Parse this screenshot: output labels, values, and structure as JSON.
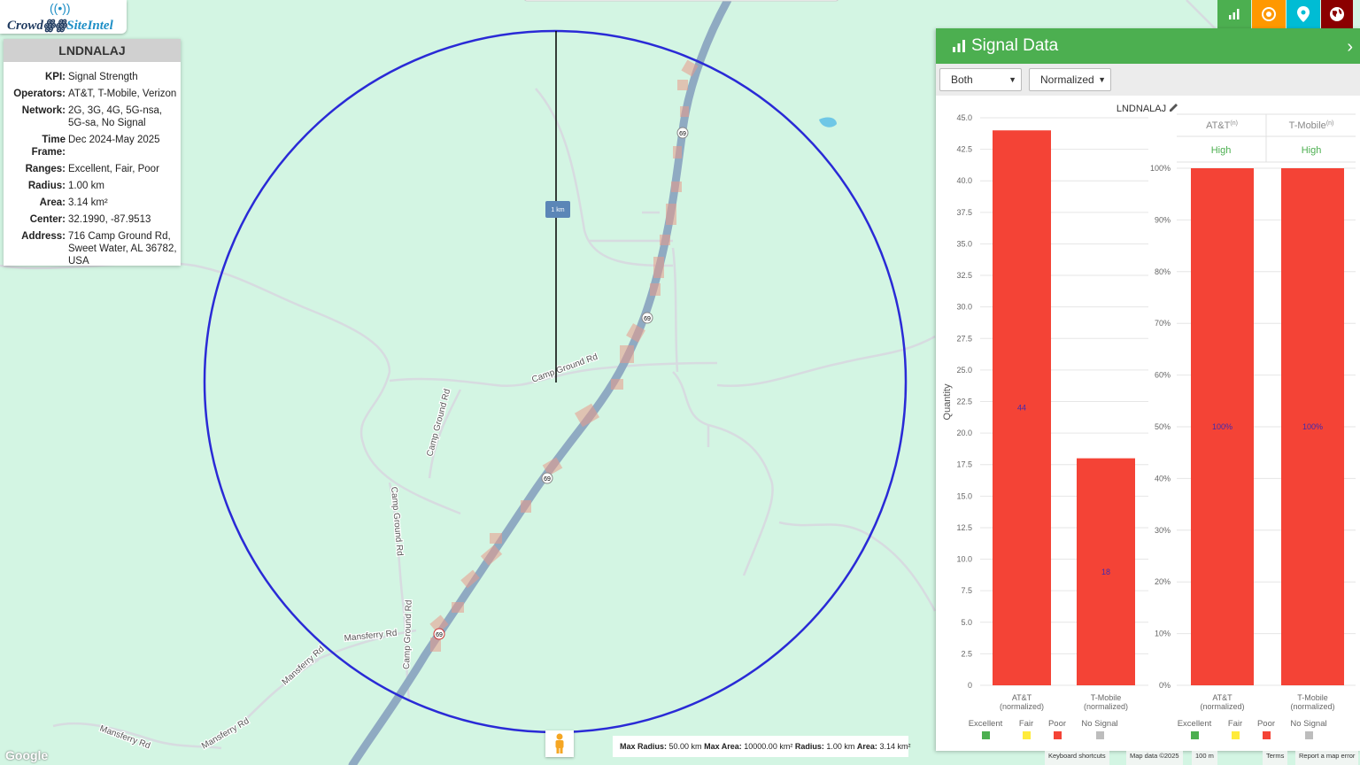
{
  "logo": {
    "part1": "Crowd",
    "part2": "SiteIntel"
  },
  "info": {
    "title": "LNDNALAJ",
    "rows": [
      {
        "label": "KPI:",
        "value": "Signal Strength"
      },
      {
        "label": "Operators:",
        "value": "AT&T, T-Mobile, Verizon"
      },
      {
        "label": "Network:",
        "value": "2G, 3G, 4G, 5G-nsa, 5G-sa, No Signal"
      },
      {
        "label": "Time Frame:",
        "value": "Dec 2024-May 2025"
      },
      {
        "label": "Ranges:",
        "value": "Excellent, Fair, Poor"
      },
      {
        "label": "Radius:",
        "value": "1.00 km"
      },
      {
        "label": "Area:",
        "value": "3.14 km²"
      },
      {
        "label": "Center:",
        "value": "32.1990, -87.9513"
      },
      {
        "label": "Address:",
        "value": "716 Camp Ground Rd, Sweet Water, AL 36782, USA"
      }
    ]
  },
  "map": {
    "scale_label": "1 km",
    "roads": [
      "Camp Ground Rd",
      "Camp Ground Rd",
      "Camp Ground Rd",
      "Camp Ground Rd",
      "Mansferry Rd",
      "Mansferry Rd",
      "Mansferry Rd",
      "Mansferry Rd"
    ],
    "shields": [
      "69",
      "69",
      "69",
      "69"
    ],
    "circle_color": "#2a2ad6"
  },
  "panel": {
    "title": "Signal Data",
    "select_operator": "Both",
    "select_mode": "Normalized",
    "chart_title": "LNDNALAJ",
    "table": {
      "col1": "AT&T",
      "col2": "T-Mobile",
      "sup": "(n)",
      "row_val1": "High",
      "row_val2": "High"
    }
  },
  "legend": [
    {
      "label": "Excellent",
      "color": "#4caf50"
    },
    {
      "label": "Fair",
      "color": "#ffeb3b"
    },
    {
      "label": "Poor",
      "color": "#f44336"
    },
    {
      "label": "No Signal",
      "color": "#bdbdbd"
    }
  ],
  "chart_data": [
    {
      "type": "bar",
      "title": "LNDNALAJ",
      "ylabel": "Quantity",
      "ylim": [
        0,
        45
      ],
      "yticks": [
        "0",
        "2.5",
        "5.0",
        "7.5",
        "10.0",
        "12.5",
        "15.0",
        "17.5",
        "20.0",
        "22.5",
        "25.0",
        "27.5",
        "30.0",
        "32.5",
        "35.0",
        "37.5",
        "40.0",
        "42.5",
        "45.0"
      ],
      "categories": [
        [
          "AT&T",
          "(normalized)"
        ],
        [
          "T-Mobile",
          "(normalized)"
        ]
      ],
      "values": [
        44,
        18
      ],
      "color": "#f44336"
    },
    {
      "type": "bar",
      "ylim": [
        0,
        100
      ],
      "yticks": [
        "0%",
        "10%",
        "20%",
        "30%",
        "40%",
        "50%",
        "60%",
        "70%",
        "80%",
        "90%",
        "100%"
      ],
      "categories": [
        [
          "AT&T",
          "(normalized)"
        ],
        [
          "T-Mobile",
          "(normalized)"
        ]
      ],
      "values": [
        100,
        100
      ],
      "value_labels": [
        "100%",
        "100%"
      ],
      "color": "#f44336"
    }
  ],
  "footer": {
    "stats": [
      {
        "label": "Max Radius:",
        "value": "50.00 km"
      },
      {
        "label": "Max Area:",
        "value": "10000.00 km²"
      },
      {
        "label": "Radius:",
        "value": "1.00 km"
      },
      {
        "label": "Area:",
        "value": "3.14 km²"
      }
    ],
    "google": "Google",
    "keyboard": "Keyboard shortcuts",
    "mapdata": "Map data ©2025",
    "scale": "100 m",
    "terms": "Terms",
    "report": "Report a map error"
  },
  "top_buttons": [
    {
      "icon": "bar-chart-icon",
      "color": "#4caf50"
    },
    {
      "icon": "target-icon",
      "color": "#ff9800"
    },
    {
      "icon": "location-pin-icon",
      "color": "#00bcd4"
    },
    {
      "icon": "globe-icon",
      "color": "#8b0000"
    }
  ]
}
